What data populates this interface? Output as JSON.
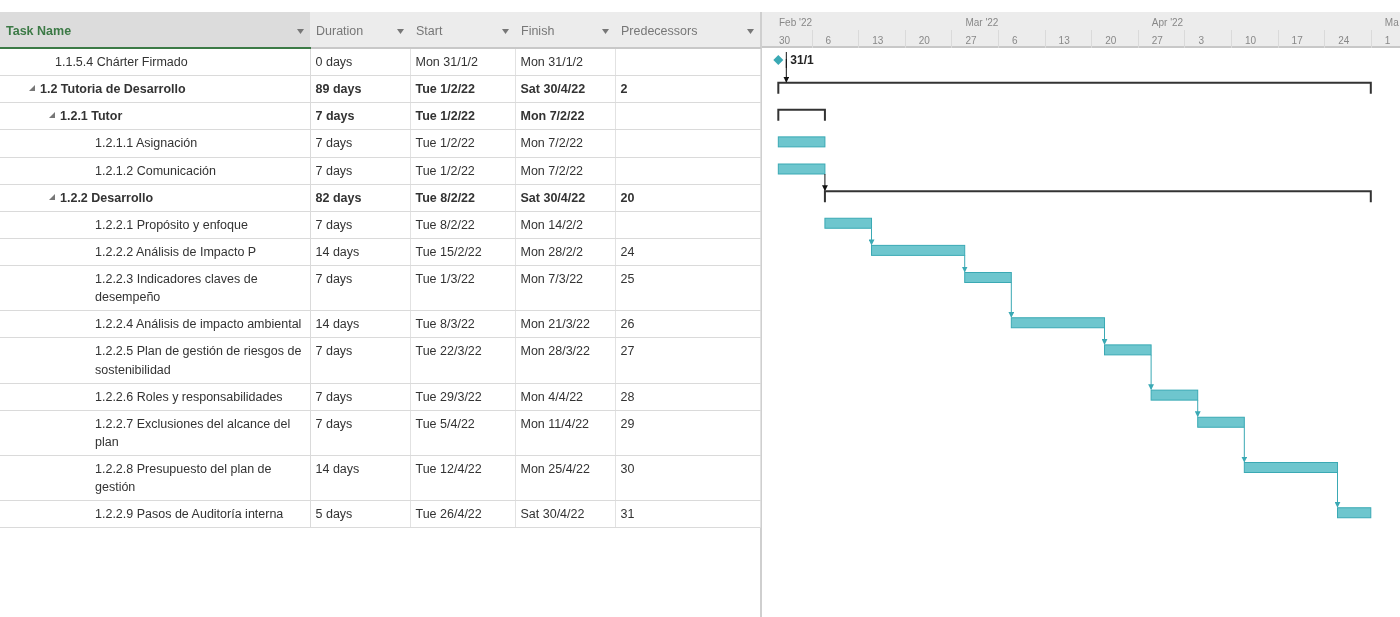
{
  "columns": [
    {
      "label": "Task Name",
      "selected": true
    },
    {
      "label": "Duration",
      "selected": false
    },
    {
      "label": "Start",
      "selected": false
    },
    {
      "label": "Finish",
      "selected": false
    },
    {
      "label": "Predecessors",
      "selected": false
    }
  ],
  "timeline": {
    "weeks": [
      {
        "label": "30",
        "month": "Feb '22"
      },
      {
        "label": "6"
      },
      {
        "label": "13"
      },
      {
        "label": "20"
      },
      {
        "label": "27",
        "month": "Mar '22"
      },
      {
        "label": "6"
      },
      {
        "label": "13"
      },
      {
        "label": "20"
      },
      {
        "label": "27",
        "month": "Apr '22"
      },
      {
        "label": "3"
      },
      {
        "label": "10"
      },
      {
        "label": "17"
      },
      {
        "label": "24"
      },
      {
        "label": "1",
        "month": "Ma"
      }
    ]
  },
  "tasks": [
    {
      "name": "1.1.5.4 Chárter Firmado",
      "duration": "0 days",
      "start": "Mon 31/1/2",
      "finish": "Mon 31/1/2",
      "kind": "milestone",
      "label": "31/1"
    },
    {
      "name": "1.2 Tutoria de Desarrollo",
      "duration": "89 days",
      "start": "Tue 1/2/22",
      "finish": "Sat 30/4/22",
      "predecessors": "2",
      "kind": "summary",
      "expanded": true,
      "children": [
        {
          "name": "1.2.1 Tutor",
          "duration": "7 days",
          "start": "Tue 1/2/22",
          "finish": "Mon 7/2/22",
          "kind": "summary",
          "expanded": true,
          "children": [
            {
              "name": "1.2.1.1 Asignación",
              "duration": "7 days",
              "start": "Tue 1/2/22",
              "finish": "Mon 7/2/22",
              "kind": "task"
            },
            {
              "name": "1.2.1.2 Comunicación",
              "duration": "7 days",
              "start": "Tue 1/2/22",
              "finish": "Mon 7/2/22",
              "kind": "task"
            }
          ]
        },
        {
          "name": "1.2.2 Desarrollo",
          "duration": "82 days",
          "start": "Tue 8/2/22",
          "finish": "Sat 30/4/22",
          "predecessors": "20",
          "kind": "summary",
          "expanded": true,
          "children": [
            {
              "name": "1.2.2.1 Propósito y enfoque",
              "duration": "7 days",
              "start": "Tue 8/2/22",
              "finish": "Mon 14/2/2",
              "kind": "task"
            },
            {
              "name": "1.2.2.2 Análisis de Impacto P",
              "duration": "14 days",
              "start": "Tue 15/2/22",
              "finish": "Mon 28/2/2",
              "predecessors": "24",
              "kind": "task"
            },
            {
              "name": "1.2.2.3 Indicadores claves de desempeño",
              "duration": "7 days",
              "start": "Tue 1/3/22",
              "finish": "Mon 7/3/22",
              "predecessors": "25",
              "kind": "task"
            },
            {
              "name": "1.2.2.4 Análisis de impacto ambiental",
              "duration": "14 days",
              "start": "Tue 8/3/22",
              "finish": "Mon 21/3/22",
              "predecessors": "26",
              "kind": "task"
            },
            {
              "name": "1.2.2.5 Plan de gestión de riesgos de sostenibilidad",
              "duration": "7 days",
              "start": "Tue 22/3/22",
              "finish": "Mon 28/3/22",
              "predecessors": "27",
              "kind": "task"
            },
            {
              "name": "1.2.2.6 Roles y responsabilidades",
              "duration": "7 days",
              "start": "Tue 29/3/22",
              "finish": "Mon 4/4/22",
              "predecessors": "28",
              "kind": "task"
            },
            {
              "name": "1.2.2.7 Exclusiones del alcance del plan",
              "duration": "7 days",
              "start": "Tue 5/4/22",
              "finish": "Mon 11/4/22",
              "predecessors": "29",
              "kind": "task"
            },
            {
              "name": "1.2.2.8 Presupuesto del plan de gestión",
              "duration": "14 days",
              "start": "Tue 12/4/22",
              "finish": "Mon 25/4/22",
              "predecessors": "30",
              "kind": "task"
            },
            {
              "name": "1.2.2.9 Pasos de Auditoría interna",
              "duration": "5 days",
              "start": "Tue 26/4/22",
              "finish": "Sat 30/4/22",
              "predecessors": "31",
              "kind": "task"
            }
          ]
        }
      ]
    }
  ]
}
